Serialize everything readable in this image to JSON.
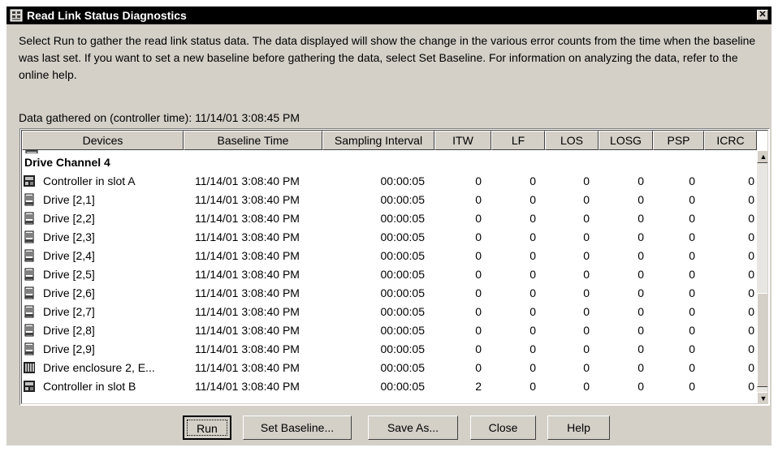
{
  "window": {
    "title": "Read Link Status Diagnostics",
    "close_glyph": "✕"
  },
  "description": "Select Run to gather the read link status data.  The data displayed will show the change in the various error counts from the time when the baseline was last set.  If you want to set a new baseline before gathering the data, select Set Baseline.  For information on analyzing the data, refer to the online help.",
  "gathered": "Data gathered on (controller time): 11/14/01 3:08:45 PM",
  "table": {
    "headers": [
      "Devices",
      "Baseline Time",
      "Sampling Interval",
      "ITW",
      "LF",
      "LOS",
      "LOSG",
      "PSP",
      "ICRC"
    ],
    "group": "Drive Channel 4",
    "rows": [
      {
        "icon": "controller-icon",
        "device": "Controller in slot A",
        "time": "11/14/01 3:08:40 PM",
        "interval": "00:00:05",
        "itw": "0",
        "lf": "0",
        "los": "0",
        "losg": "0",
        "psp": "0",
        "icrc": "0"
      },
      {
        "icon": "drive-icon",
        "device": "Drive [2,1]",
        "time": "11/14/01 3:08:40 PM",
        "interval": "00:00:05",
        "itw": "0",
        "lf": "0",
        "los": "0",
        "losg": "0",
        "psp": "0",
        "icrc": "0"
      },
      {
        "icon": "drive-icon",
        "device": "Drive [2,2]",
        "time": "11/14/01 3:08:40 PM",
        "interval": "00:00:05",
        "itw": "0",
        "lf": "0",
        "los": "0",
        "losg": "0",
        "psp": "0",
        "icrc": "0"
      },
      {
        "icon": "drive-icon",
        "device": "Drive [2,3]",
        "time": "11/14/01 3:08:40 PM",
        "interval": "00:00:05",
        "itw": "0",
        "lf": "0",
        "los": "0",
        "losg": "0",
        "psp": "0",
        "icrc": "0"
      },
      {
        "icon": "drive-icon",
        "device": "Drive [2,4]",
        "time": "11/14/01 3:08:40 PM",
        "interval": "00:00:05",
        "itw": "0",
        "lf": "0",
        "los": "0",
        "losg": "0",
        "psp": "0",
        "icrc": "0"
      },
      {
        "icon": "drive-icon",
        "device": "Drive [2,5]",
        "time": "11/14/01 3:08:40 PM",
        "interval": "00:00:05",
        "itw": "0",
        "lf": "0",
        "los": "0",
        "losg": "0",
        "psp": "0",
        "icrc": "0"
      },
      {
        "icon": "drive-icon",
        "device": "Drive [2,6]",
        "time": "11/14/01 3:08:40 PM",
        "interval": "00:00:05",
        "itw": "0",
        "lf": "0",
        "los": "0",
        "losg": "0",
        "psp": "0",
        "icrc": "0"
      },
      {
        "icon": "drive-icon",
        "device": "Drive [2,7]",
        "time": "11/14/01 3:08:40 PM",
        "interval": "00:00:05",
        "itw": "0",
        "lf": "0",
        "los": "0",
        "losg": "0",
        "psp": "0",
        "icrc": "0"
      },
      {
        "icon": "drive-icon",
        "device": "Drive [2,8]",
        "time": "11/14/01 3:08:40 PM",
        "interval": "00:00:05",
        "itw": "0",
        "lf": "0",
        "los": "0",
        "losg": "0",
        "psp": "0",
        "icrc": "0"
      },
      {
        "icon": "drive-icon",
        "device": "Drive [2,9]",
        "time": "11/14/01 3:08:40 PM",
        "interval": "00:00:05",
        "itw": "0",
        "lf": "0",
        "los": "0",
        "losg": "0",
        "psp": "0",
        "icrc": "0"
      },
      {
        "icon": "enclosure-icon",
        "device": "Drive enclosure 2, E...",
        "time": "11/14/01 3:08:40 PM",
        "interval": "00:00:05",
        "itw": "0",
        "lf": "0",
        "los": "0",
        "losg": "0",
        "psp": "0",
        "icrc": "0"
      },
      {
        "icon": "controller-icon",
        "device": "Controller in slot B",
        "time": "11/14/01 3:08:40 PM",
        "interval": "00:00:05",
        "itw": "2",
        "lf": "0",
        "los": "0",
        "losg": "0",
        "psp": "0",
        "icrc": "0"
      }
    ]
  },
  "scrollbar": {
    "up_glyph": "▲",
    "down_glyph": "▼"
  },
  "buttons": {
    "run": "Run",
    "set_baseline": "Set Baseline...",
    "save_as": "Save As...",
    "close": "Close",
    "help": "Help"
  },
  "colors": {
    "titlebar": "#000000",
    "face": "#d4d0c8",
    "table_bg": "#ffffff"
  }
}
